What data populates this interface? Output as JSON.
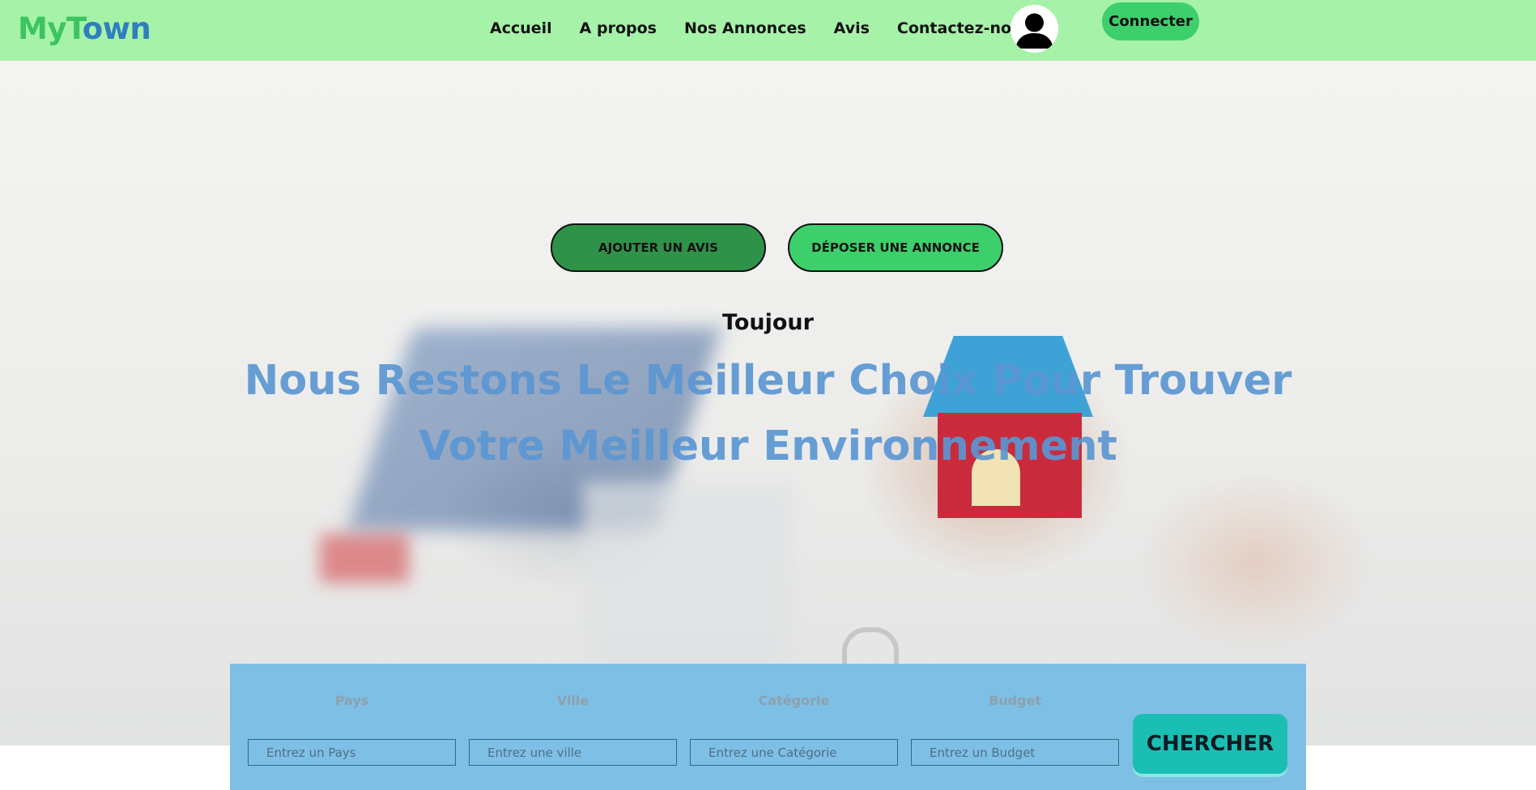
{
  "brand": {
    "part1": "My",
    "part2": "T",
    "part3": "own"
  },
  "nav": {
    "items": [
      {
        "label": "Accueil"
      },
      {
        "label": "A propos"
      },
      {
        "label": "Nos Annonces"
      },
      {
        "label": "Avis"
      },
      {
        "label": "Contactez-nous"
      }
    ],
    "connect_label": "Connecter"
  },
  "hero": {
    "add_review_label": "Ajouter un avis",
    "post_ad_label": "Déposer une annonce",
    "tagline": "Toujour",
    "headline_line1": "Nous Restons Le Meilleur Choix Pour Trouver",
    "headline_line2": "Votre Meilleur Environnement"
  },
  "search": {
    "fields": [
      {
        "label": "Pays",
        "placeholder": "Entrez un Pays"
      },
      {
        "label": "Ville",
        "placeholder": "Entrez une ville"
      },
      {
        "label": "Catégorie",
        "placeholder": "Entrez une Catégorie"
      },
      {
        "label": "Budget",
        "placeholder": "Entrez un Budget"
      }
    ],
    "submit_label": "CHERCHER"
  },
  "colors": {
    "navbar_bg": "#a6f2a8",
    "brand_green": "#3cc462",
    "brand_blue": "#2f7fbf",
    "accent_green": "#3dcf6b",
    "dark_green": "#2f9249",
    "search_panel": "#7ebfe6",
    "search_button": "#1bbeb2"
  },
  "icons": {
    "avatar": "user-avatar-icon"
  }
}
